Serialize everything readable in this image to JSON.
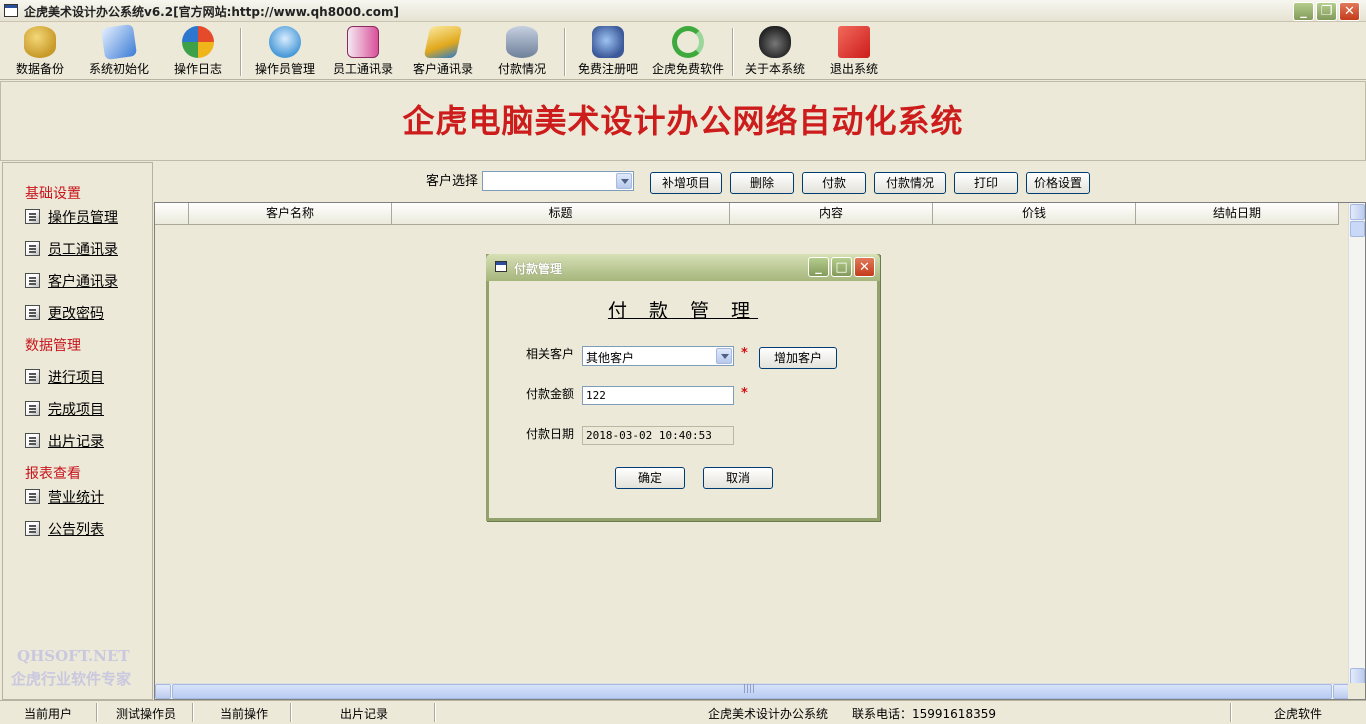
{
  "window": {
    "title": "企虎美术设计办公系统v6.2[官方网站:http://www.qh8000.com]"
  },
  "toolbar": {
    "items": [
      {
        "label": "数据备份",
        "icon": "database-backup-icon",
        "color": "#c89a2a"
      },
      {
        "label": "系统初始化",
        "icon": "notebook-pen-icon",
        "color": "#3a7bd5"
      },
      {
        "label": "操作日志",
        "icon": "checkmark-globe-icon",
        "color": "#d9542b"
      },
      {
        "label": "操作员管理",
        "icon": "users-chat-icon",
        "color": "#4a9ad8"
      },
      {
        "label": "员工通讯录",
        "icon": "address-book-icon",
        "color": "#d9509a"
      },
      {
        "label": "客户通讯录",
        "icon": "notebook-icon",
        "color": "#e0a81c"
      },
      {
        "label": "付款情况",
        "icon": "database-add-icon",
        "color": "#6e7f99"
      },
      {
        "label": "免费注册吧",
        "icon": "monitor-globe-icon",
        "color": "#3c5a9a"
      },
      {
        "label": "企虎免费软件",
        "icon": "refresh-icon",
        "color": "#3eaa3e"
      },
      {
        "label": "关于本系统",
        "icon": "mascot-icon",
        "color": "#333333"
      },
      {
        "label": "退出系统",
        "icon": "exit-cube-icon",
        "color": "#cc1c1c"
      }
    ]
  },
  "banner": {
    "title": "企虎电脑美术设计办公网络自动化系统"
  },
  "sidebar": {
    "groups": [
      {
        "title": "基础设置",
        "items": [
          "操作员管理",
          "员工通讯录",
          "客户通讯录",
          "更改密码"
        ]
      },
      {
        "title": "数据管理",
        "items": [
          "进行项目",
          "完成项目",
          "出片记录"
        ]
      },
      {
        "title": "报表查看",
        "items": [
          "营业统计",
          "公告列表"
        ]
      }
    ],
    "watermark_line1": "QHSOFT.NET",
    "watermark_line2": "企虎行业软件专家"
  },
  "filter": {
    "customer_label": "客户选择",
    "customer_value": "",
    "buttons": [
      "补增项目",
      "删除",
      "付款",
      "付款情况",
      "打印",
      "价格设置"
    ]
  },
  "table": {
    "columns": [
      "",
      "客户名称",
      "标题",
      "内容",
      "价钱",
      "结帖日期"
    ],
    "rows": []
  },
  "dialog": {
    "title": "付款管理",
    "heading": "付 款 管 理",
    "customer_label": "相关客户",
    "customer_value": "其他客户",
    "add_customer_button": "增加客户",
    "amount_label": "付款金额",
    "amount_value": "122",
    "date_label": "付款日期",
    "date_value": "2018-03-02 10:40:53",
    "required_mark": "*",
    "ok_button": "确定",
    "cancel_button": "取消"
  },
  "statusbar": {
    "current_user_label": "当前用户",
    "current_user_value": "测试操作员",
    "current_op_label": "当前操作",
    "current_op_value": "出片记录",
    "system_name": "企虎美术设计办公系统",
    "phone": "联系电话：15991618359",
    "brand": "企虎软件"
  }
}
